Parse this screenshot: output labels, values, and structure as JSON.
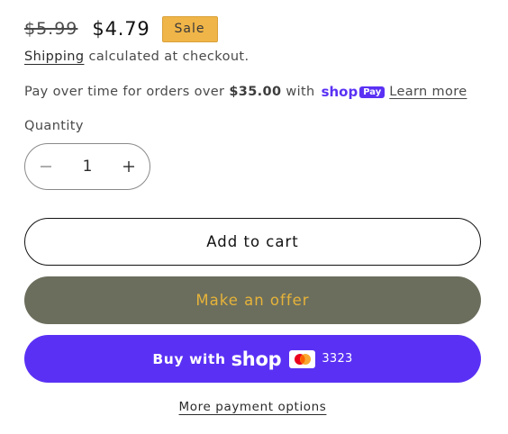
{
  "price": {
    "regular": "$5.99",
    "sale": "$4.79",
    "badge": "Sale"
  },
  "shipping": {
    "link_label": "Shipping",
    "text": " calculated at checkout."
  },
  "installments": {
    "prefix": "Pay over time for orders over",
    "amount": "$35.00",
    "with": "with",
    "shop_word": "shop",
    "pay_word": "Pay",
    "learn_more": "Learn more"
  },
  "quantity": {
    "label": "Quantity",
    "value": "1"
  },
  "buttons": {
    "add_to_cart": "Add to cart",
    "make_offer": "Make an offer",
    "buy_with": "Buy with",
    "shop_word": "shop",
    "card_last4": "3323"
  },
  "more_payment_options": "More payment options",
  "colors": {
    "sale_badge": "#f0b548",
    "offer_button": "#6b6e5d",
    "offer_text": "#e6b33a",
    "shop_pay_purple": "#5a31f4"
  },
  "icons": {
    "minus": "minus-icon",
    "plus": "plus-icon",
    "card": "mastercard-icon"
  }
}
